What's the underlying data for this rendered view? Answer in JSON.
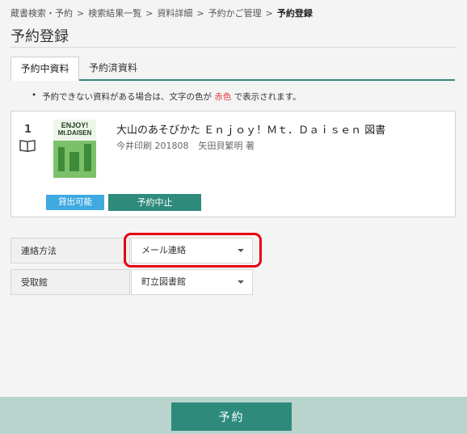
{
  "breadcrumb": {
    "items": [
      "蔵書検索・予約",
      "検索結果一覧",
      "資料詳細",
      "予約かご管理"
    ],
    "current": "予約登録",
    "separator": ">"
  },
  "page": {
    "title": "予約登録"
  },
  "tabs": [
    {
      "label": "予約中資料",
      "active": true
    },
    {
      "label": "予約済資料",
      "active": false
    }
  ],
  "notice": {
    "bullet": "•",
    "before": "予約できない資料がある場合は、文字の色が",
    "highlight": "赤色",
    "after": "で表示されます。"
  },
  "item": {
    "number": "1",
    "icon": "book-icon",
    "cover_text_line1": "ENJOY!",
    "cover_text_line2": "Mt.DAISEN",
    "title": "大山のあそびかた Ｅｎｊｏｙ！Ｍｔ．Ｄａｉｓｅｎ 図書",
    "publisher": "今井印刷 201808",
    "author": "矢田貝繁明 著",
    "status": "貸出可能",
    "cancel_label": "予約中止"
  },
  "form": {
    "contact_label": "連絡方法",
    "contact_value": "メール連絡",
    "pickup_label": "受取館",
    "pickup_value": "町立図書館"
  },
  "footer": {
    "reserve_label": "予約"
  },
  "colors": {
    "accent": "#2e8b7c",
    "status_blue": "#3fa9e0",
    "highlight_red": "#e60012",
    "footer_bg": "#b9d3cd"
  }
}
